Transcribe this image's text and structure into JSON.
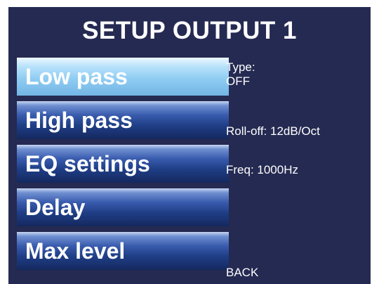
{
  "screen": {
    "title": "SETUP OUTPUT 1"
  },
  "menu": {
    "items": [
      {
        "label": "Low pass",
        "selected": true
      },
      {
        "label": "High pass",
        "selected": false
      },
      {
        "label": "EQ settings",
        "selected": false
      },
      {
        "label": "Delay",
        "selected": false
      },
      {
        "label": "Max level",
        "selected": false
      }
    ]
  },
  "info": {
    "type_label": "Type:",
    "type_value": "OFF",
    "rolloff": "Roll-off: 12dB/Oct",
    "freq": "Freq: 1000Hz",
    "back": "BACK"
  },
  "colors": {
    "panel_background": "#252a52",
    "selected_button": "#8fccf2",
    "button": "#203f88",
    "text": "#ffffff"
  }
}
